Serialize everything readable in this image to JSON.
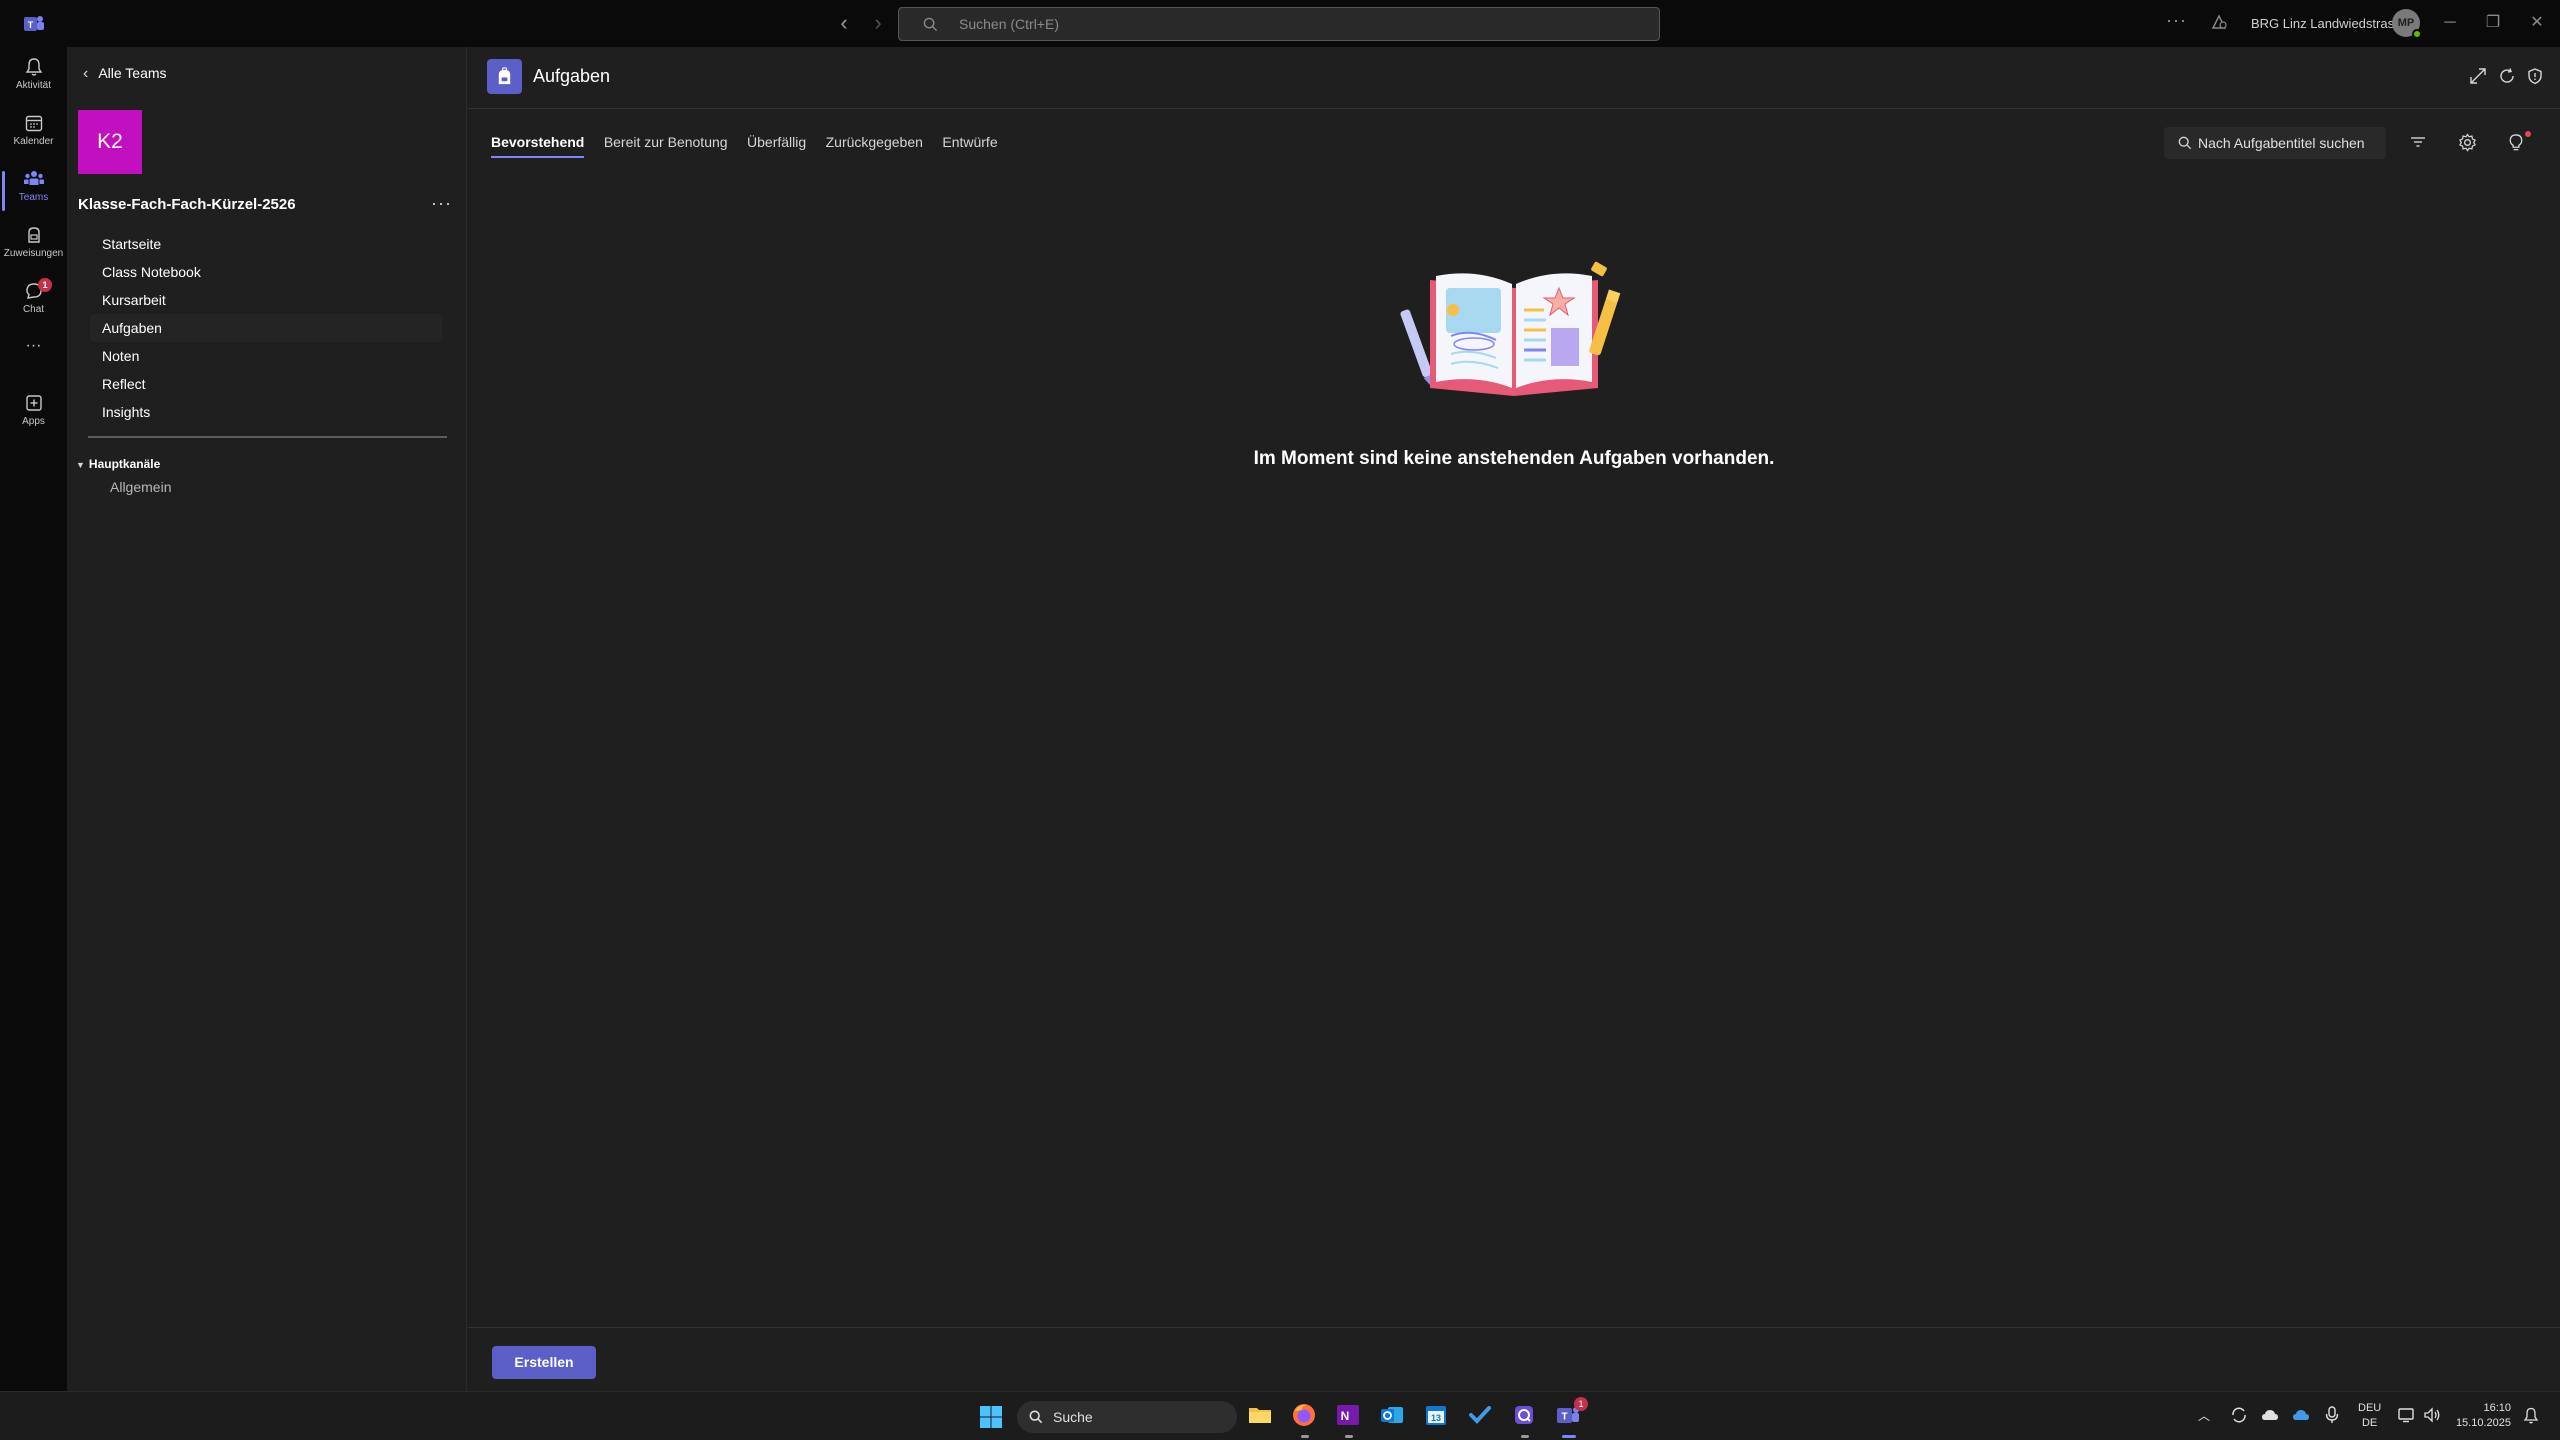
{
  "titlebar": {
    "search_placeholder": "Suchen (Ctrl+E)",
    "org_name": "BRG Linz Landwiedstrasse",
    "avatar_initials": "MP"
  },
  "rail": {
    "items": [
      {
        "label": "Aktivität",
        "icon": "bell-icon"
      },
      {
        "label": "Kalender",
        "icon": "calendar-icon"
      },
      {
        "label": "Teams",
        "icon": "teams-icon"
      },
      {
        "label": "Zuweisungen",
        "icon": "backpack-icon"
      },
      {
        "label": "Chat",
        "icon": "chat-icon",
        "badge": "1"
      },
      {
        "label": "Apps",
        "icon": "apps-icon"
      }
    ]
  },
  "sidebar": {
    "back_label": "Alle Teams",
    "team_avatar": "K2",
    "team_name": "Klasse-Fach-Fach-Kürzel-2526",
    "nav": [
      {
        "label": "Startseite"
      },
      {
        "label": "Class Notebook"
      },
      {
        "label": "Kursarbeit"
      },
      {
        "label": "Aufgaben",
        "selected": true
      },
      {
        "label": "Noten"
      },
      {
        "label": "Reflect"
      },
      {
        "label": "Insights"
      }
    ],
    "channels_header": "Hauptkanäle",
    "channels": [
      "Allgemein"
    ]
  },
  "main": {
    "title": "Aufgaben",
    "tabs": [
      "Bevorstehend",
      "Bereit zur Benotung",
      "Überfällig",
      "Zurückgegeben",
      "Entwürfe"
    ],
    "active_tab": "Bevorstehend",
    "search_placeholder": "Nach Aufgabentitel suchen",
    "empty_message": "Im Moment sind keine anstehenden Aufgaben vorhanden.",
    "create_label": "Erstellen"
  },
  "taskbar": {
    "search_label": "Suche",
    "teams_badge": "1",
    "lang_top": "DEU",
    "lang_bottom": "DE",
    "time": "16:10",
    "date": "15.10.2025"
  },
  "colors": {
    "accent": "#5b5fc7",
    "accent_light": "#7f85f5",
    "team_avatar_bg": "#c20fc0",
    "background": "#1f1f1f",
    "rail_bg": "#0a0a0a",
    "badge": "#c4314b"
  }
}
